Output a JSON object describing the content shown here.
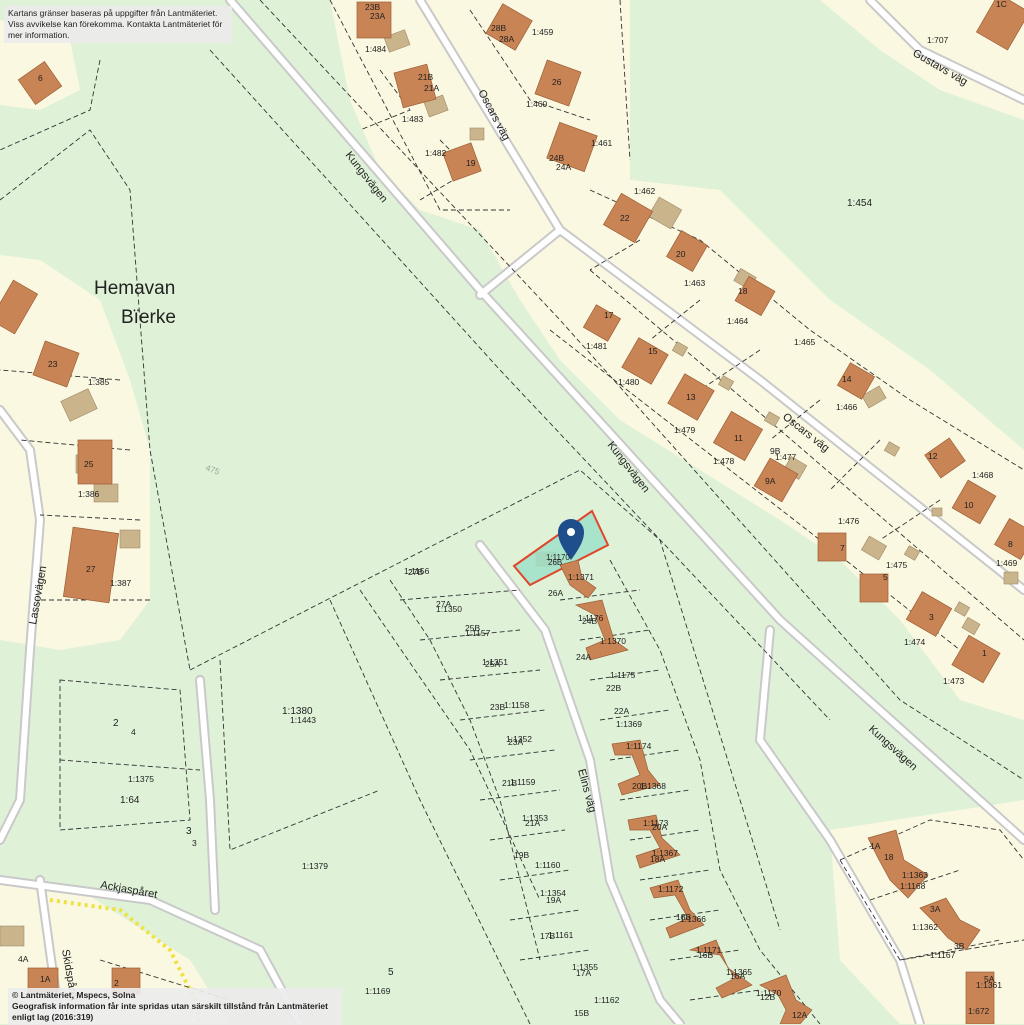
{
  "notes": {
    "top_line1": "Kartans gränser baseras på uppgifter från Lantmäteriet.",
    "top_line2": "Viss avvikelse kan förekomma. Kontakta Lantmäteriet för mer information.",
    "bottom_line1": "© Lantmäteriet, Mspecs, Solna",
    "bottom_line2": "Geografisk information får inte spridas utan särskilt tillstånd från Lantmäteriet enligt lag (2016:319)"
  },
  "place": {
    "name1": "Hemavan",
    "name2": "Bïerke"
  },
  "selected_property": {
    "label": "1:1170",
    "house": "26B"
  },
  "colors": {
    "house": "#c98455",
    "outbuilding": "#c9b48c",
    "selected_fill": "#9fe0c9",
    "selected_border": "#e0452a",
    "pin": "#1f4e8c",
    "trail": "#f0e040"
  },
  "roads": [
    {
      "name": "Kungsvägen"
    },
    {
      "name": "Kungsvägen"
    },
    {
      "name": "Kungsvägen"
    },
    {
      "name": "Oscars väg"
    },
    {
      "name": "Oscars väg"
    },
    {
      "name": "Gustavs väg"
    },
    {
      "name": "Lassovägen"
    },
    {
      "name": "Ackjaspåret"
    },
    {
      "name": "Skidspåret"
    },
    {
      "name": "Elins väg"
    }
  ],
  "labels": [
    "6",
    "23B",
    "23A",
    "1:484",
    "21B",
    "21A",
    "1:483",
    "1:482",
    "19",
    "28B",
    "28A",
    "1:459",
    "1:460",
    "26",
    "24B",
    "24A",
    "1:461",
    "1:462",
    "22",
    "20",
    "1:463",
    "18",
    "1:464",
    "1:454",
    "1:465",
    "17",
    "1:481",
    "15",
    "1:480",
    "13",
    "1:479",
    "14",
    "1:466",
    "11",
    "1:478",
    "9B",
    "1:477",
    "9A",
    "1:476",
    "12",
    "1:468",
    "10",
    "1:469",
    "8",
    "7",
    "5",
    "1:475",
    "3",
    "1:474",
    "1",
    "1:473",
    "1:707",
    "1C",
    "23",
    "1:385",
    "25",
    "1:386",
    "27",
    "1:387",
    "475",
    "1:1156",
    "27B",
    "27A",
    "1:1350",
    "25B",
    "1:1157",
    "1:1351",
    "25A",
    "1:1371",
    "26A",
    "1:1176",
    "24B",
    "1:1370",
    "24A",
    "1:1175",
    "22B",
    "22A",
    "1:1369",
    "23B",
    "1:1158",
    "1:1352",
    "23A",
    "21B",
    "1:1159",
    "1:1174",
    "20B",
    "1:1368",
    "1:1353",
    "21A",
    "1:1173",
    "19B",
    "1:1160",
    "20A",
    "1:1367",
    "18A",
    "1:1354",
    "19A",
    "1:1172",
    "18B",
    "1:1366",
    "17B",
    "1:1161",
    "1:1171",
    "16B",
    "1:1365",
    "16A",
    "1:1355",
    "17A",
    "1:1162",
    "15B",
    "1:1170",
    "12B",
    "12A",
    "1:1380",
    "1:1443",
    "2",
    "4",
    "1:1375",
    "1:64",
    "3",
    "3",
    "1:1379",
    "5",
    "1:1169",
    "1A",
    "18",
    "1:1363",
    "1:1168",
    "3A",
    "1:1362",
    "3B",
    "1:1167",
    "5A",
    "1:1361",
    "1:672",
    "4A",
    "1A",
    "2"
  ]
}
